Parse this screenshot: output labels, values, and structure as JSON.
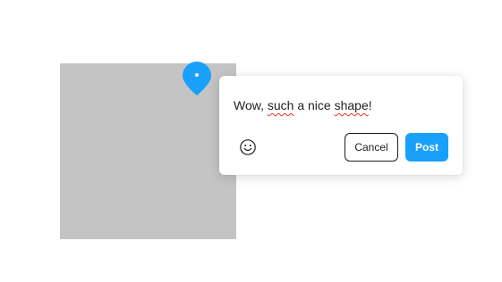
{
  "colors": {
    "canvas_bg": "#ffffff",
    "shape_fill": "#c4c4c4",
    "accent": "#18a0fb",
    "text": "#1e1e1e",
    "spellcheck_underline": "#e03131"
  },
  "comment": {
    "pin_icon": "comment-pin-icon",
    "text_parts": {
      "p1": "Wow, ",
      "p2": "such",
      "p3": " a nice ",
      "p4": "shape",
      "p5": "!"
    },
    "emoji_icon": "smiley-face-icon",
    "cancel_label": "Cancel",
    "post_label": "Post"
  }
}
